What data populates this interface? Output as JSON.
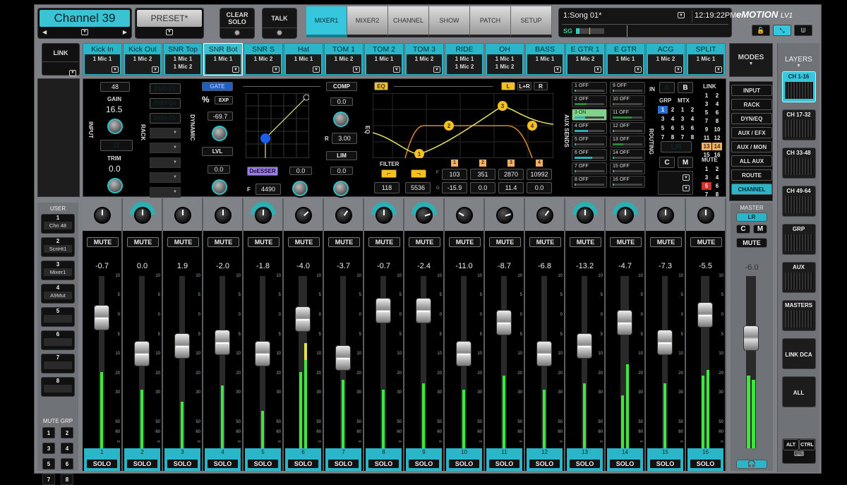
{
  "header": {
    "channel_name": "Channel 39",
    "preset": "PRESET*",
    "clear_solo": "CLEAR SOLO",
    "talk": "TALK",
    "tabs": [
      {
        "label": "MIXER1",
        "active": true
      },
      {
        "label": "MIXER2",
        "active": false
      },
      {
        "label": "CHANNEL",
        "active": false
      },
      {
        "label": "SHOW",
        "active": false
      },
      {
        "label": "PATCH",
        "active": false
      },
      {
        "label": "SETUP",
        "active": false
      }
    ],
    "song": "1:Song 01*",
    "time": "12:19:22PM",
    "sg_label": "SG",
    "logo": "eMOTION",
    "logo_suffix": "LV1"
  },
  "link": {
    "label": "LINK"
  },
  "channel_names": [
    {
      "name": "Kick In",
      "inputs": [
        "1 Mic 1"
      ]
    },
    {
      "name": "Kick Out",
      "inputs": [
        "1 Mic 2"
      ]
    },
    {
      "name": "SNR Top",
      "inputs": [
        "1 Mic 1",
        "1 Mic 2"
      ]
    },
    {
      "name": "SNR Bot",
      "inputs": [
        "1 Mic 1"
      ],
      "selected": true
    },
    {
      "name": "SNR S",
      "inputs": [
        "1 Mic 2"
      ]
    },
    {
      "name": "Hat",
      "inputs": [
        "1 Mic 1"
      ]
    },
    {
      "name": "TOM 1",
      "inputs": [
        "1 Mic 2"
      ]
    },
    {
      "name": "TOM 2",
      "inputs": [
        "1 Mic 1"
      ]
    },
    {
      "name": "TOM 3",
      "inputs": [
        "1 Mic 2"
      ]
    },
    {
      "name": "RIDE",
      "inputs": [
        "1 Mic 1",
        "1 Mic 2"
      ]
    },
    {
      "name": "OH",
      "inputs": [
        "1 Mic 1",
        "1 Mic 2"
      ]
    },
    {
      "name": "BASS",
      "inputs": [
        "1 Mic 1"
      ]
    },
    {
      "name": "E GTR 1",
      "inputs": [
        "1 Mic 2"
      ]
    },
    {
      "name": "E GTR",
      "inputs": [
        "1 Mic 1"
      ]
    },
    {
      "name": "ACG",
      "inputs": [
        "1 Mic 2"
      ]
    },
    {
      "name": "SPLIT",
      "inputs": [
        "1 Mic 1"
      ]
    }
  ],
  "modes": {
    "title": "MODES",
    "items": [
      {
        "label": "INPUT",
        "active": false
      },
      {
        "label": "RACK",
        "active": false
      },
      {
        "label": "DYN/EQ",
        "active": false
      },
      {
        "label": "AUX / EFX",
        "active": false
      },
      {
        "label": "AUX / MON",
        "active": false
      },
      {
        "label": "ALL AUX",
        "active": false
      },
      {
        "label": "ROUTE",
        "active": false
      },
      {
        "label": "CHANNEL",
        "active": true
      }
    ]
  },
  "input": {
    "section": "INPUT",
    "input_num": "48",
    "gain_label": "GAIN",
    "gain": "16.5",
    "phase": "Ø",
    "trim_label": "TRIM",
    "trim": "0.0"
  },
  "rack": {
    "section": "RACK",
    "slots": [
      "EMO-F2",
      "EMO-Q4",
      "EMO-D5",
      "",
      "",
      "",
      "",
      ""
    ]
  },
  "dynamics": {
    "section": "DYNAMIC",
    "gate": "GATE",
    "exp": "EXP",
    "threshold": "-69.7",
    "lvl_label": "LVL",
    "lvl": "0.0",
    "deesser": "DeESSER",
    "deesser_val": "0.0",
    "f_label": "F",
    "f_val": "4490",
    "comp": "COMP",
    "comp_val": "0.0",
    "ratio_label": "R",
    "ratio": "3.00",
    "lim": "LIM",
    "lim_val": "0.0"
  },
  "eq": {
    "section": "EQ",
    "label": "EQ",
    "channel_buttons": [
      {
        "label": "L",
        "active": true
      },
      {
        "label": "L+R",
        "active": false
      },
      {
        "label": "R",
        "active": false
      }
    ],
    "filter_label": "FILTER",
    "hpf": "118",
    "lpf": "5536",
    "f_label": "F",
    "g_label": "G",
    "bands": [
      {
        "n": "1",
        "f": "103",
        "g": "-15.9"
      },
      {
        "n": "2",
        "f": "351",
        "g": "0.0"
      },
      {
        "n": "3",
        "f": "2870",
        "g": "11.4"
      },
      {
        "n": "4",
        "f": "10992",
        "g": "0.0"
      }
    ]
  },
  "aux_sends": {
    "section": "AUX SENDS",
    "items": [
      {
        "label": "1 OFF",
        "level": 0.05,
        "on": false
      },
      {
        "label": "2 OFF",
        "level": 0.4,
        "on": false
      },
      {
        "label": "3 ON",
        "level": 0.35,
        "on": true
      },
      {
        "label": "4 OFF",
        "level": 0.45,
        "on": false
      },
      {
        "label": "5 OFF",
        "level": 0.05,
        "on": false
      },
      {
        "label": "6 OFF",
        "level": 0.6,
        "on": false
      },
      {
        "label": "7 OFF",
        "level": 0.05,
        "on": false
      },
      {
        "label": "8 OFF",
        "level": 0.05,
        "on": false
      },
      {
        "label": "9 OFF",
        "level": 0.05,
        "on": false
      },
      {
        "label": "10 OFF",
        "level": 0.05,
        "on": false
      },
      {
        "label": "11 OFF",
        "level": 0.65,
        "on": false
      },
      {
        "label": "12 OFF",
        "level": 0.05,
        "on": false
      },
      {
        "label": "13 OFF",
        "level": 0.35,
        "on": false
      },
      {
        "label": "14 OFF",
        "level": 0.05,
        "on": false
      },
      {
        "label": "15 OFF",
        "level": 0.05,
        "on": false
      },
      {
        "label": "16 OFF",
        "level": 0.05,
        "on": false
      }
    ]
  },
  "routing": {
    "section": "ROUTING",
    "in_label": "IN",
    "in_a": "A",
    "in_b": "B",
    "grp_label": "GRP",
    "mtx_label": "MTX",
    "grp": [
      "1",
      "2",
      "3",
      "4",
      "5",
      "6",
      "7",
      "8"
    ],
    "grp_active": "1",
    "mtx": [
      "1",
      "2",
      "3",
      "4",
      "5",
      "6",
      "7",
      "8"
    ],
    "lr": "L/R",
    "c": "C",
    "m": "M",
    "link_label": "LINK",
    "link": [
      "1",
      "2",
      "3",
      "4",
      "5",
      "6",
      "7",
      "8",
      "9",
      "10",
      "11",
      "12",
      "13",
      "14",
      "15",
      "16"
    ],
    "link_active": [
      "13",
      "14"
    ],
    "mute_label": "MUTE",
    "mute": [
      "1",
      "2",
      "3",
      "4",
      "5",
      "6",
      "7",
      "8"
    ],
    "mute_active": [
      "5"
    ]
  },
  "user": {
    "title": "USER",
    "keys": [
      {
        "n": "1",
        "label": "Chn 48"
      },
      {
        "n": "2",
        "label": "ScnHt1"
      },
      {
        "n": "3",
        "label": "Mixer1"
      },
      {
        "n": "4",
        "label": "A9Mut"
      },
      {
        "n": "5",
        "label": ""
      },
      {
        "n": "6",
        "label": ""
      },
      {
        "n": "7",
        "label": ""
      },
      {
        "n": "8",
        "label": ""
      }
    ],
    "mute_grp_title": "MUTE GRP",
    "mute_grps": [
      "1",
      "2",
      "3",
      "4",
      "5",
      "6",
      "7",
      "8"
    ]
  },
  "strips": {
    "mute_label": "MUTE",
    "solo_label": "SOLO",
    "scale": [
      "10",
      "5",
      "0",
      "5",
      "10",
      "20",
      "30",
      "50",
      "60",
      "∞"
    ],
    "channels": [
      {
        "n": "1",
        "level": "-0.7",
        "fader_db": -0.7,
        "meters": [
          -16
        ],
        "pan": 0
      },
      {
        "n": "2",
        "level": "0.0",
        "fader_db": -10,
        "meters": [
          -25
        ],
        "pan": 0,
        "width": true
      },
      {
        "n": "3",
        "level": "1.9",
        "fader_db": -8,
        "meters": [
          -32
        ],
        "pan": 0
      },
      {
        "n": "4",
        "level": "-2.0",
        "fader_db": -7,
        "meters": [
          -23
        ],
        "pan": 0
      },
      {
        "n": "5",
        "level": "-1.8",
        "fader_db": -10,
        "meters": [
          -38
        ],
        "pan": 0,
        "width": true
      },
      {
        "n": "6",
        "level": "-4.0",
        "fader_db": -1,
        "meters": [
          -16,
          -10
        ],
        "pan": 0.4,
        "peak": true
      },
      {
        "n": "7",
        "level": "-3.7",
        "fader_db": -12,
        "meters": [
          -20
        ],
        "pan": 0.3
      },
      {
        "n": "8",
        "level": "-0.7",
        "fader_db": 1,
        "meters": [
          -25
        ],
        "pan": 0,
        "width": true
      },
      {
        "n": "9",
        "level": "-2.4",
        "fader_db": 1,
        "meters": [
          -22
        ],
        "pan": 0.6,
        "width": true
      },
      {
        "n": "10",
        "level": "-11.0",
        "fader_db": -10,
        "meters": [
          -25
        ],
        "pan": -0.5
      },
      {
        "n": "11",
        "level": "-8.7",
        "fader_db": -2,
        "meters": [
          -18
        ],
        "pan": 0.6
      },
      {
        "n": "12",
        "level": "-6.8",
        "fader_db": -10,
        "meters": [
          -25
        ],
        "pan": 0.3
      },
      {
        "n": "13",
        "level": "-13.2",
        "fader_db": -8,
        "meters": [
          -22
        ],
        "pan": 0,
        "width": true
      },
      {
        "n": "14",
        "level": "-4.7",
        "fader_db": -2,
        "meters": [
          -28,
          -12
        ],
        "pan": 0,
        "width": true
      },
      {
        "n": "15",
        "level": "-7.3",
        "fader_db": -7,
        "meters": [
          -22
        ],
        "pan": 0
      },
      {
        "n": "16",
        "level": "-5.5",
        "fader_db": 0,
        "meters": [
          -18,
          -15
        ],
        "pan": 0
      }
    ]
  },
  "master": {
    "title": "MASTER",
    "lr": "LR",
    "c": "C",
    "m": "M",
    "mute": "MUTE",
    "level": "-6.0",
    "fader_db": -6,
    "meters": [
      -18,
      -20
    ]
  },
  "layers": {
    "title": "LAYERS",
    "items": [
      {
        "label": "CH 1-16",
        "active": true
      },
      {
        "label": "CH 17-32",
        "active": false
      },
      {
        "label": "CH 33-48",
        "active": false
      },
      {
        "label": "CH 49-64",
        "active": false
      },
      {
        "label": "GRP",
        "active": false
      },
      {
        "label": "AUX",
        "active": false
      },
      {
        "label": "MASTERS",
        "active": false
      },
      {
        "label": "LINK DCA",
        "active": false
      },
      {
        "label": "ALL",
        "active": false
      }
    ],
    "alt": "ALT",
    "ctrl": "CTRL"
  }
}
